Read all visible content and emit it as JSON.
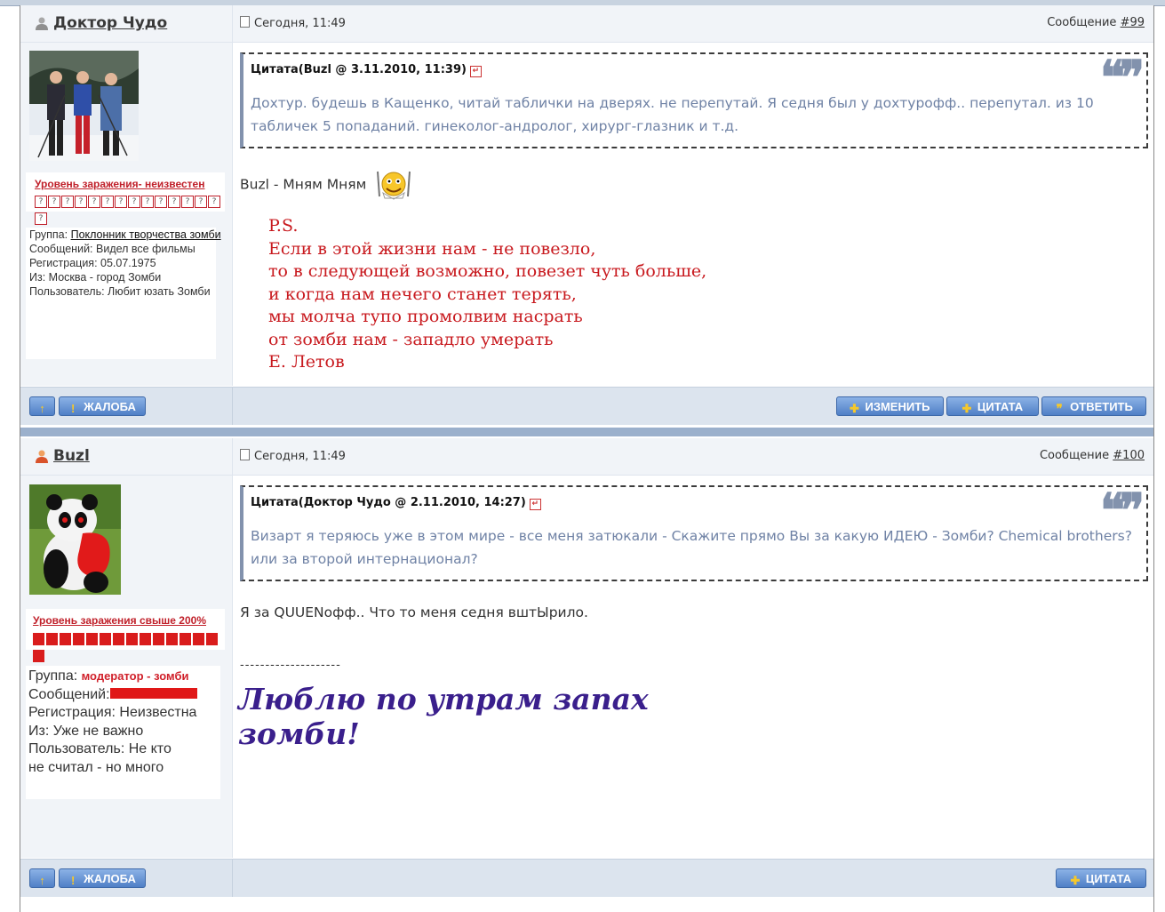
{
  "posts": [
    {
      "author": "Доктор Чудо",
      "date": "Сегодня, 11:49",
      "msg_prefix": "Сообщение",
      "msg_no": "#99",
      "level": "Уровень заражения- неизвестен",
      "level_boxes": "???????????????",
      "group_label": "Группа:",
      "group": "Поклонник творчества зомби",
      "info_lines": [
        "Сообщений: Видел все фильмы",
        "Регистрация: 05.07.1975",
        "Из: Москва - город Зомби",
        "Пользователь: Любит юзать Зомби"
      ],
      "quote_head": "Цитата(Buzl @ 3.11.2010, 11:39)",
      "quote_text": "Дохтур. будешь в Кащенко, читай таблички на дверях. не перепутай. Я седня был у дохтурофф.. перепутал. из 10 табличек 5 попаданий. гинеколог-андролог, хирург-глазник и т.д.",
      "body": "Buzl - Мням Мням",
      "ps_lines": [
        "P.S.",
        "Если в этой жизни нам - не повезло,",
        "то в следующей возможно, повезет чуть больше,",
        "и когда нам нечего станет терять,",
        "мы молча тупо промолвим насрать",
        "от зомби нам - западло умерать",
        "Е. Летов"
      ],
      "buttons": {
        "up": "↑",
        "report": "ЖАЛОБА",
        "edit": "ИЗМЕНИТЬ",
        "quote": "ЦИТАТА",
        "reply": "ОТВЕТИТЬ"
      }
    },
    {
      "author": "Buzl",
      "date": "Сегодня, 11:49",
      "msg_prefix": "Сообщение",
      "msg_no": "#100",
      "level": "Уровень заражения свыше 200%",
      "group_label": "Группа:",
      "group": "модератор - зомби",
      "messages_label": "Сообщений:",
      "info_lines": [
        "Регистрация: Неизвестна",
        "Из: Уже не важно",
        "Пользователь: Не кто",
        "не считал - но много"
      ],
      "quote_head": "Цитата(Доктор Чудо @ 2.11.2010, 14:27)",
      "quote_text": "Визарт я теряюсь уже в этом мире - все меня затюкали - Скажите прямо Вы за какую ИДЕЮ - Зомби? Chemical brothers? или за второй интернационал?",
      "body": "Я за QUUENофф.. Что то меня седня вштЫрило.",
      "sig_sep": "--------------------",
      "signature": "Люблю по утрам запах зомби!",
      "buttons": {
        "up": "↑",
        "report": "ЖАЛОБА",
        "quote": "ЦИТАТА"
      }
    }
  ],
  "colors": {
    "accent": "#4f7fc6",
    "red": "#c8191e",
    "quote_text": "#6f82a5",
    "signature": "#3a1f8c"
  }
}
